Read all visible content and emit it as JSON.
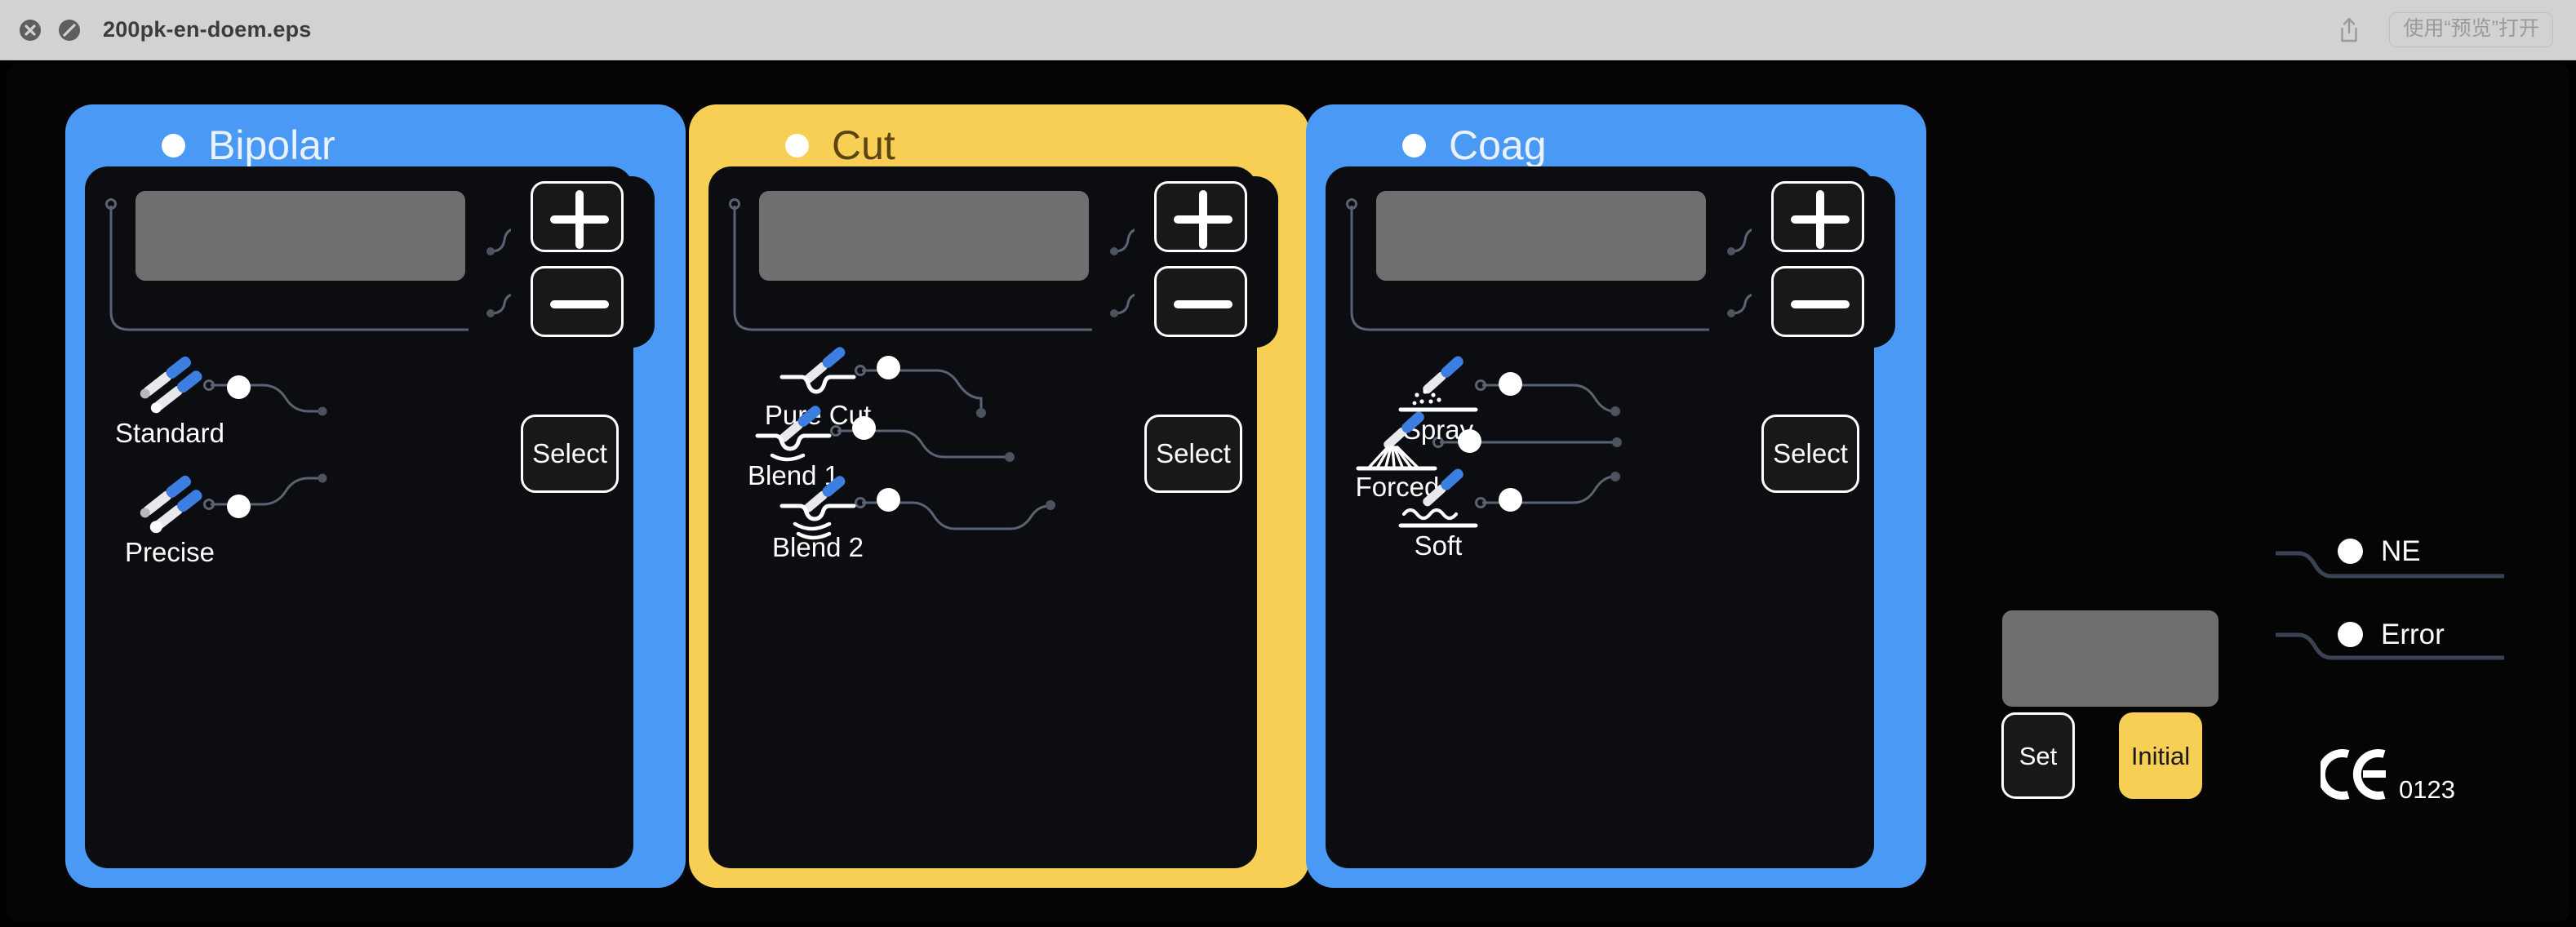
{
  "titlebar": {
    "close_icon": "close-circle-icon",
    "block_icon": "no-entry-icon",
    "filename": "200pk-en-doem.eps",
    "share_icon": "share-icon",
    "open_with_label": "使用“预览”打开"
  },
  "colors": {
    "blue": "#4a9af5",
    "yellow": "#f8cf55",
    "panel_bg": "#0b0d11",
    "lcd_grey": "#6f6f6f",
    "device_black": "#050505",
    "trace": "#5a6273",
    "cut_title": "#5b4412"
  },
  "panels": [
    {
      "id": "bipolar",
      "title": "Bipolar",
      "accent": "#4a9af5",
      "led_on": true,
      "display_value": "",
      "plus_label": "+",
      "minus_label": "−",
      "select_label": "Select",
      "modes": [
        {
          "label": "Standard",
          "icon": "bipolar-forceps-icon",
          "led": true
        },
        {
          "label": "Precise",
          "icon": "bipolar-forceps-precise-icon",
          "led": true
        }
      ]
    },
    {
      "id": "cut",
      "title": "Cut",
      "accent": "#f8cf55",
      "led_on": true,
      "display_value": "",
      "plus_label": "+",
      "minus_label": "−",
      "select_label": "Select",
      "modes": [
        {
          "label": "Pure Cut",
          "icon": "electrode-pure-cut-icon",
          "led": true
        },
        {
          "label": "Blend 1",
          "icon": "electrode-blend1-icon",
          "led": true
        },
        {
          "label": "Blend 2",
          "icon": "electrode-blend2-icon",
          "led": true
        }
      ]
    },
    {
      "id": "coag",
      "title": "Coag",
      "accent": "#4a9af5",
      "led_on": true,
      "display_value": "",
      "plus_label": "+",
      "minus_label": "−",
      "select_label": "Select",
      "modes": [
        {
          "label": "Spray",
          "icon": "electrode-spray-icon",
          "led": true
        },
        {
          "label": "Forced",
          "icon": "electrode-forced-icon",
          "led": true
        },
        {
          "label": "Soft",
          "icon": "electrode-soft-icon",
          "led": true
        }
      ]
    }
  ],
  "right_module": {
    "display_value": "",
    "indicators": [
      {
        "label": "NE",
        "led": true
      },
      {
        "label": "Error",
        "led": true
      }
    ],
    "buttons": [
      {
        "id": "set",
        "label": "Set"
      },
      {
        "id": "initial",
        "label": "Initial"
      }
    ],
    "ce_mark": {
      "symbol": "ce-mark-icon",
      "number": "0123"
    }
  }
}
